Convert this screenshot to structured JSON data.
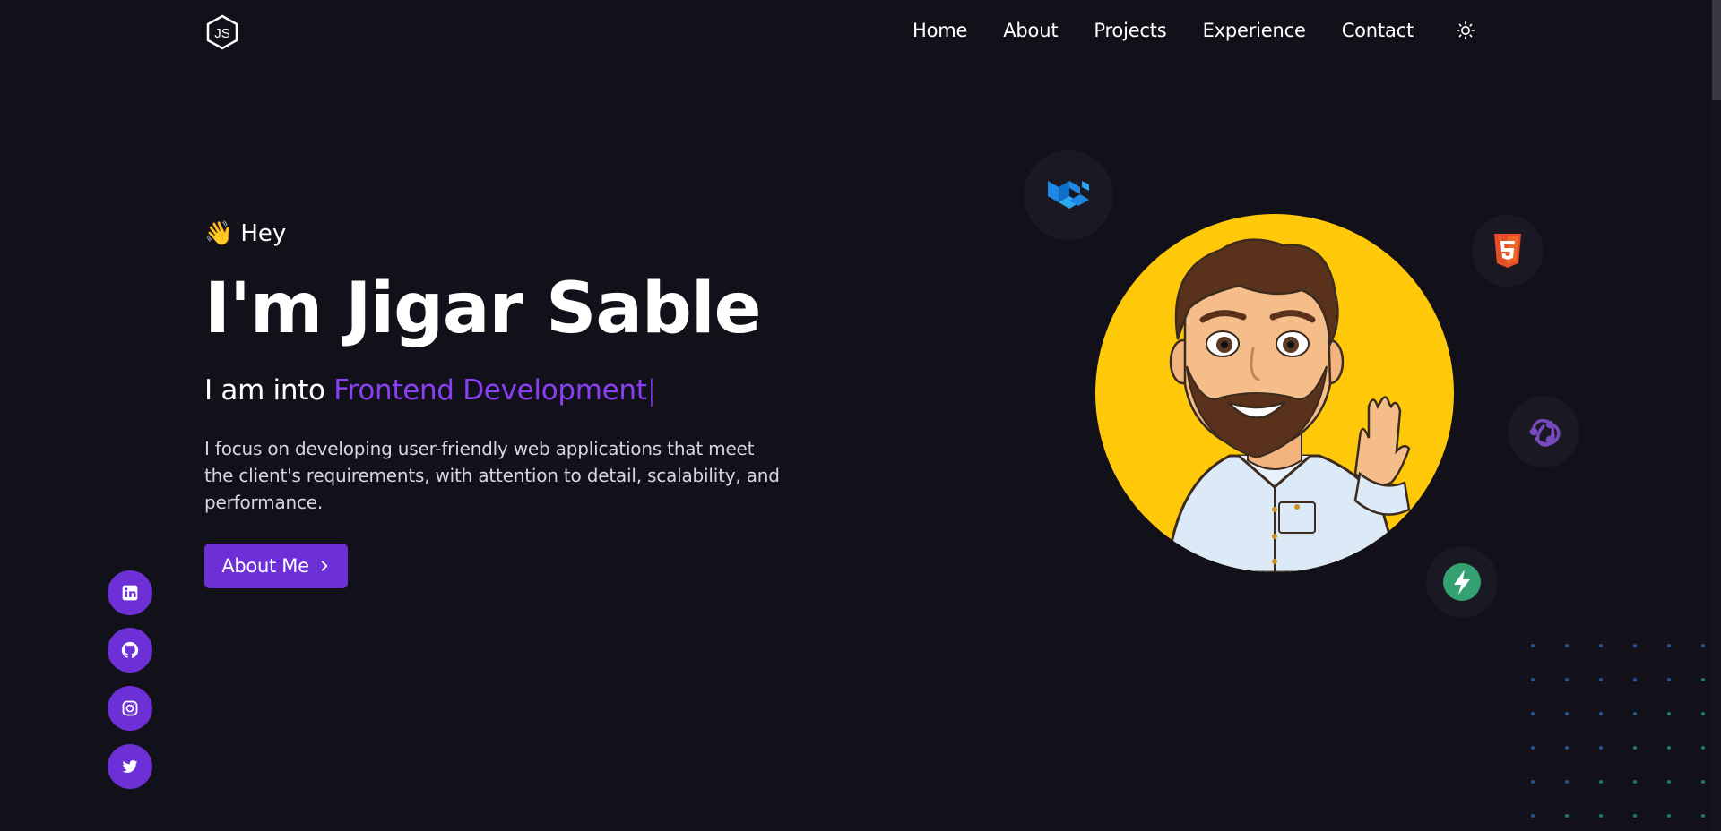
{
  "nav": {
    "logo_text": "JS",
    "links": [
      "Home",
      "About",
      "Projects",
      "Experience",
      "Contact"
    ],
    "theme_icon": "sun-icon"
  },
  "hero": {
    "greeting_emoji": "👋",
    "greeting": "Hey",
    "name": "I'm Jigar Sable",
    "tagline_prefix": "I am into ",
    "tagline_role": "Frontend Development",
    "cursor": "|",
    "description": "I focus on developing user-friendly web applications that meet the client's requirements, with attention to detail, scalability, and performance.",
    "cta_label": "About Me"
  },
  "social": [
    "linkedin-icon",
    "github-icon",
    "instagram-icon",
    "twitter-icon"
  ],
  "tech_icons": [
    "material-ui-icon",
    "html5-icon",
    "redux-icon",
    "supabase-icon"
  ],
  "colors": {
    "background": "#121019",
    "accent": "#6d2fd6",
    "accent_text": "#8a3ff5",
    "avatar_bg": "#ffc90a"
  }
}
